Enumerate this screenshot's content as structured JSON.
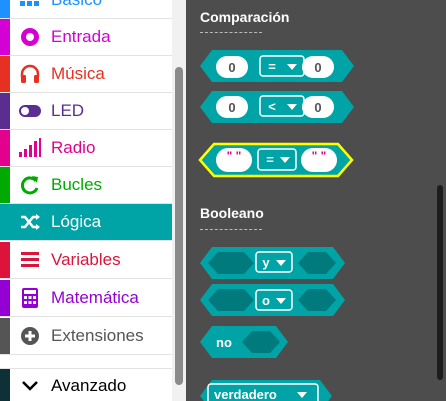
{
  "sidebar": {
    "categories": [
      {
        "label": "Básico",
        "color": "#1e90ff",
        "icon": "grid-icon"
      },
      {
        "label": "Entrada",
        "color": "#d400d4",
        "icon": "radio-target-icon"
      },
      {
        "label": "Música",
        "color": "#e63022",
        "icon": "headphones-icon"
      },
      {
        "label": "LED",
        "color": "#5c2d91",
        "icon": "toggle-icon"
      },
      {
        "label": "Radio",
        "color": "#e3008c",
        "icon": "signal-bars-icon"
      },
      {
        "label": "Bucles",
        "color": "#00aa00",
        "icon": "loop-arrow-icon"
      },
      {
        "label": "Lógica",
        "color": "#00a4a6",
        "icon": "shuffle-icon",
        "selected": true
      },
      {
        "label": "Variables",
        "color": "#dc143c",
        "icon": "list-lines-icon"
      },
      {
        "label": "Matemática",
        "color": "#9400d3",
        "icon": "calculator-icon"
      },
      {
        "label": "Extensiones",
        "color": "#555555",
        "icon": "plus-circle-icon"
      }
    ],
    "advanced": {
      "label": "Avanzado",
      "icon": "chevron-down-icon"
    }
  },
  "flyout": {
    "block_color": "#00a4a6",
    "sections": {
      "comparison": "Comparación",
      "boolean": "Booleano"
    },
    "blocks": {
      "compare_equal": {
        "left": "0",
        "operator": "=",
        "right": "0"
      },
      "compare_less": {
        "left": "0",
        "operator": "<",
        "right": "0"
      },
      "compare_text": {
        "left": "\" \"",
        "operator": "=",
        "right": "\" \""
      },
      "and_block": {
        "operator": "y"
      },
      "or_block": {
        "operator": "o"
      },
      "not_block": {
        "label": "no"
      },
      "true_block": {
        "label": "verdadero"
      }
    }
  }
}
